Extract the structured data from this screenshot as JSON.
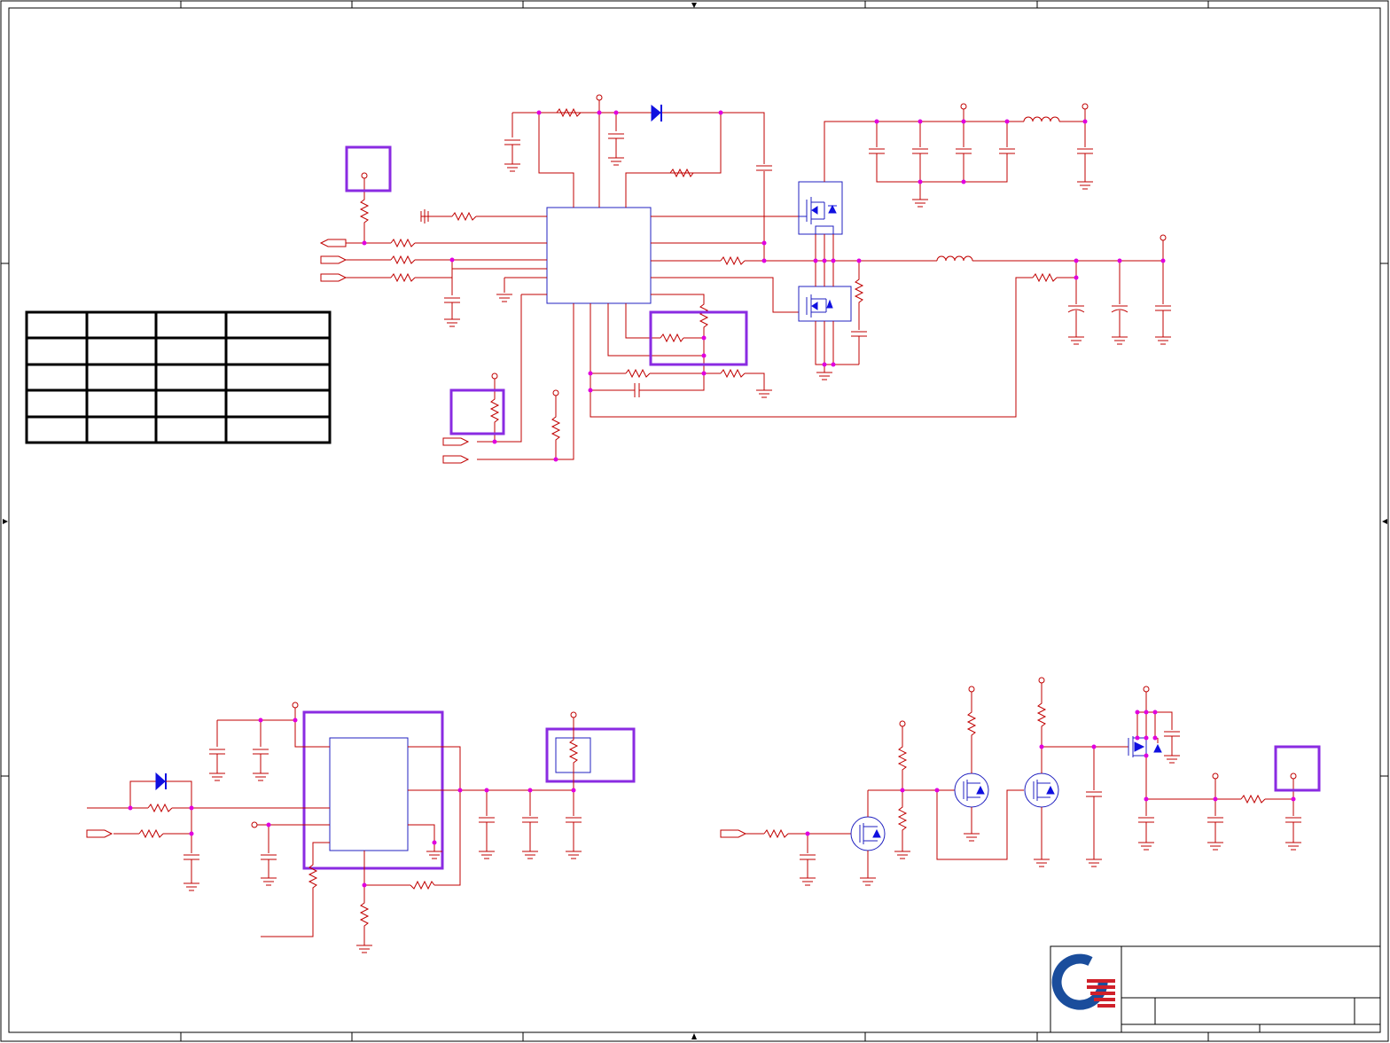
{
  "sheet": {
    "background": "#ffffff",
    "wire_color": "#c00000",
    "component_outline_color": "#2020c0",
    "junction_color": "#e000e0",
    "highlight_color": "#8a2be2",
    "diode_color": "#1010e0"
  },
  "table": {
    "rows": [
      [
        "",
        "",
        "",
        ""
      ],
      [
        "",
        "",
        "",
        ""
      ],
      [
        "",
        "",
        "",
        ""
      ],
      [
        "",
        "",
        "",
        ""
      ],
      [
        "",
        "",
        "",
        ""
      ]
    ]
  },
  "title_block": {
    "logo": "company-logo-icon",
    "logo_colors": [
      "#1a4d9c",
      "#d0202a"
    ]
  }
}
